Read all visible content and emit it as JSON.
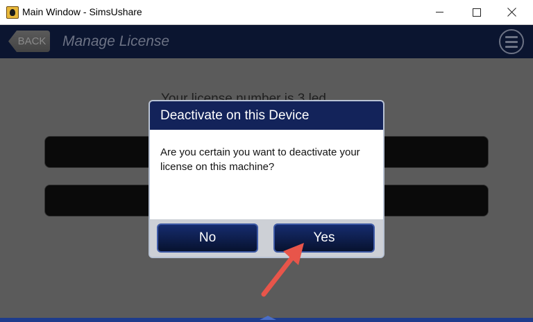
{
  "window": {
    "title": "Main Window - SimsUshare",
    "icon": "simsushare-app-icon",
    "controls": [
      "minimize-icon",
      "maximize-icon",
      "close-icon"
    ]
  },
  "header": {
    "back_label": "BACK",
    "title": "Manage License",
    "menu_icon": "hamburger-menu-icon"
  },
  "background": {
    "status_text": "Your license number is 3 led"
  },
  "dialog": {
    "title": "Deactivate on this Device",
    "message": "Are you certain you want to deactivate your license on this machine?",
    "no_label": "No",
    "yes_label": "Yes"
  },
  "colors": {
    "header_bg": "#0b1530",
    "dialog_header": "#13235a",
    "button_border": "#3e5aa6",
    "annotation_arrow": "#e8554a"
  }
}
